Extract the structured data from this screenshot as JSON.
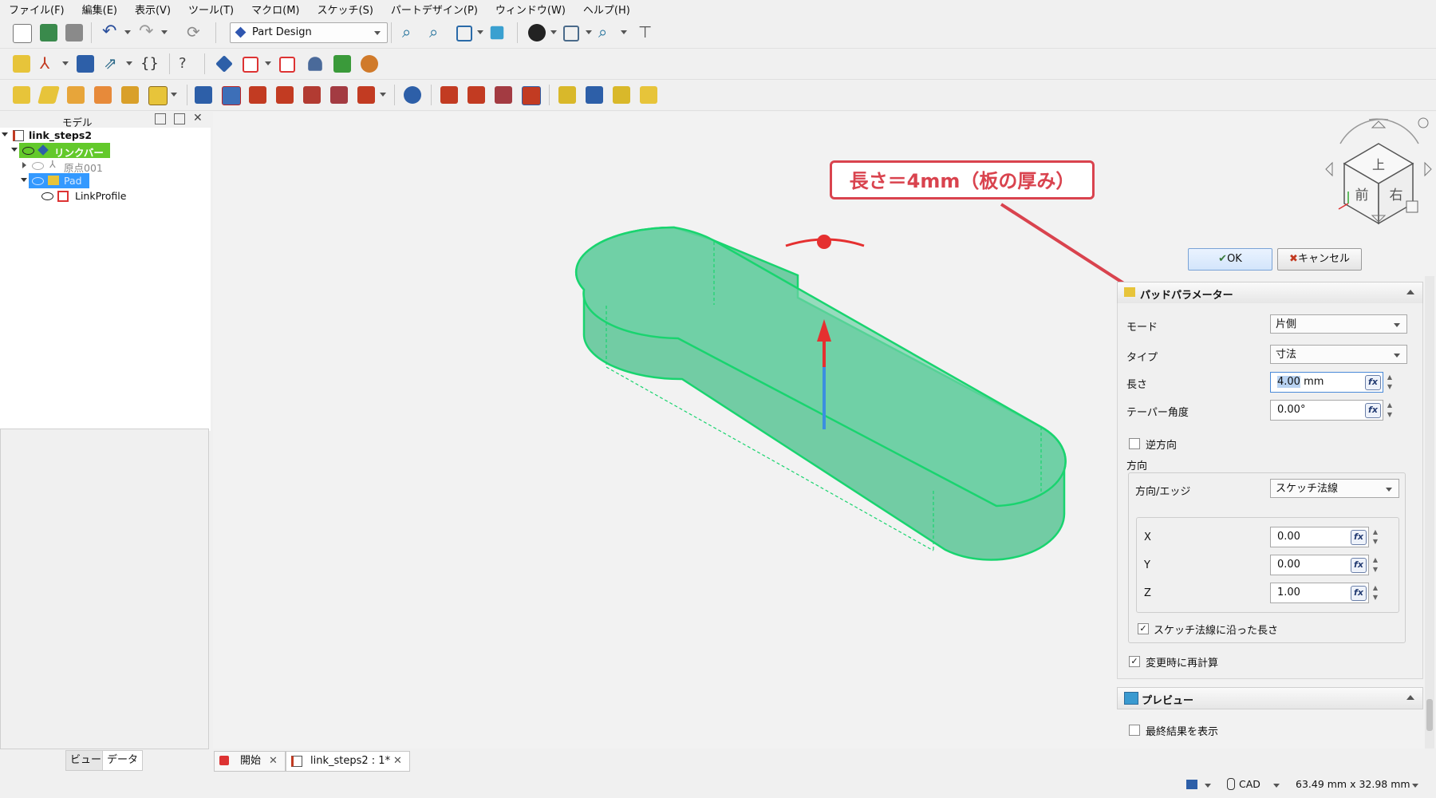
{
  "menu": [
    "ファイル(F)",
    "編集(E)",
    "表示(V)",
    "ツール(T)",
    "マクロ(M)",
    "スケッチ(S)",
    "パートデザイン(P)",
    "ウィンドウ(W)",
    "ヘルプ(H)"
  ],
  "workbench": {
    "label": "Part Design"
  },
  "panel": {
    "title": "モデル",
    "tab_view": "ビュー",
    "tab_data": "データ"
  },
  "tree": {
    "root": "link_steps2",
    "link": "リンクバー",
    "origin": "原点001",
    "pad": "Pad",
    "profile": "LinkProfile"
  },
  "annotation": {
    "text": "長さ＝4mm（板の厚み）"
  },
  "navcube": {
    "top": "上",
    "front": "前",
    "right": "右"
  },
  "buttons": {
    "ok": "OK",
    "cancel": "キャンセル"
  },
  "pad_params": {
    "header": "パッドパラメーター",
    "mode_label": "モード",
    "mode_value": "片側",
    "type_label": "タイプ",
    "type_value": "寸法",
    "length_label": "長さ",
    "length_value": "4.00",
    "length_unit": "mm",
    "taper_label": "テーパー角度",
    "taper_value": "0.00°",
    "reverse_label": "逆方向",
    "direction_label": "方向",
    "dir_edge_label": "方向/エッジ",
    "dir_edge_value": "スケッチ法線",
    "x_label": "X",
    "x_value": "0.00",
    "y_label": "Y",
    "y_value": "0.00",
    "z_label": "Z",
    "z_value": "1.00",
    "along_normal_label": "スケッチ法線に沿った長さ",
    "recompute_label": "変更時に再計算",
    "fx": "fx"
  },
  "preview": {
    "header": "プレビュー",
    "show_final_label": "最終結果を表示"
  },
  "doc_tabs": {
    "start": "開始",
    "doc": "link_steps2 : 1*"
  },
  "status": {
    "nav_style": "CAD",
    "dims": "63.49 mm x 32.98 mm"
  },
  "colors": {
    "accent_red": "#d9434e",
    "pad_fill": "#5cc596",
    "pad_edge": "#19d46f",
    "tree_selected_green": "#63c92b",
    "tree_selected_blue": "#3399ff"
  }
}
